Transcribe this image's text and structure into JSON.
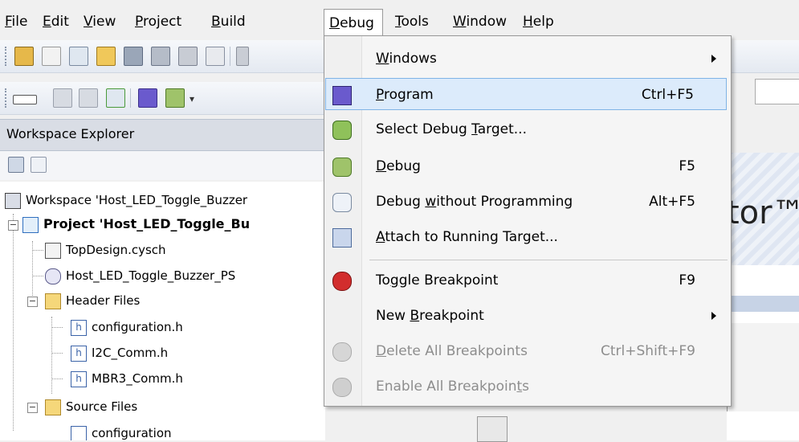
{
  "menubar": {
    "items": [
      {
        "label": "File",
        "mn": "F",
        "rest": "ile"
      },
      {
        "label": "Edit",
        "mn": "E",
        "rest": "dit"
      },
      {
        "label": "View",
        "mn": "V",
        "rest": "iew"
      },
      {
        "label": "Project",
        "mn": "P",
        "rest": "roject"
      },
      {
        "label": "Build",
        "mn": "B",
        "rest": "uild"
      },
      {
        "label": "Debug",
        "mn": "D",
        "rest": "ebug"
      },
      {
        "label": "Tools",
        "mn": "T",
        "rest": "ools"
      },
      {
        "label": "Window",
        "mn": "W",
        "rest": "indow"
      },
      {
        "label": "Help",
        "mn": "H",
        "rest": "elp"
      }
    ]
  },
  "workspace_explorer": {
    "title": "Workspace Explorer",
    "workspace_label": "Workspace 'Host_LED_Toggle_Buzzer",
    "project_label": "Project 'Host_LED_Toggle_Bu",
    "topdesign": "TopDesign.cysch",
    "psoc": "Host_LED_Toggle_Buzzer_PS",
    "header_folder": "Header Files",
    "headers": [
      "configuration.h",
      "I2C_Comm.h",
      "MBR3_Comm.h"
    ],
    "source_folder": "Source Files",
    "source_partial": "configuration"
  },
  "background": {
    "tm_text": "tor™"
  },
  "debug_menu": {
    "items": [
      {
        "name": "windows",
        "pre": "",
        "mn": "W",
        "post": "indows",
        "shortcut": "",
        "submenu": true,
        "disabled": false
      },
      {
        "name": "program",
        "pre": "",
        "mn": "P",
        "post": "rogram",
        "shortcut": "Ctrl+F5",
        "submenu": false,
        "disabled": false
      },
      {
        "name": "select-debug-target",
        "pre": "Select Debug ",
        "mn": "T",
        "post": "arget...",
        "shortcut": "",
        "submenu": false,
        "disabled": false
      },
      {
        "name": "debug",
        "pre": "",
        "mn": "D",
        "post": "ebug",
        "shortcut": "F5",
        "submenu": false,
        "disabled": false
      },
      {
        "name": "debug-without-programming",
        "pre": "Debug ",
        "mn": "w",
        "post": "ithout Programming",
        "shortcut": "Alt+F5",
        "submenu": false,
        "disabled": false
      },
      {
        "name": "attach-to-running-target",
        "pre": "",
        "mn": "A",
        "post": "ttach to Running Target...",
        "shortcut": "",
        "submenu": false,
        "disabled": false
      },
      {
        "name": "toggle-breakpoint",
        "pre": "To",
        "mn": "g",
        "post": "gle Breakpoint",
        "shortcut": "F9",
        "submenu": false,
        "disabled": false
      },
      {
        "name": "new-breakpoint",
        "pre": "New ",
        "mn": "B",
        "post": "reakpoint",
        "shortcut": "",
        "submenu": true,
        "disabled": false
      },
      {
        "name": "delete-all-breakpoints",
        "pre": "",
        "mn": "D",
        "post": "elete All Breakpoints",
        "shortcut": "Ctrl+Shift+F9",
        "submenu": false,
        "disabled": true
      },
      {
        "name": "enable-all-breakpoints",
        "pre": "Enable All Breakpoin",
        "mn": "t",
        "post": "s",
        "shortcut": "",
        "submenu": false,
        "disabled": true
      }
    ]
  },
  "colors": {
    "highlight": "#dcebfb",
    "highlight_border": "#7fb3e6",
    "disabled_text": "#8d8d8d"
  }
}
